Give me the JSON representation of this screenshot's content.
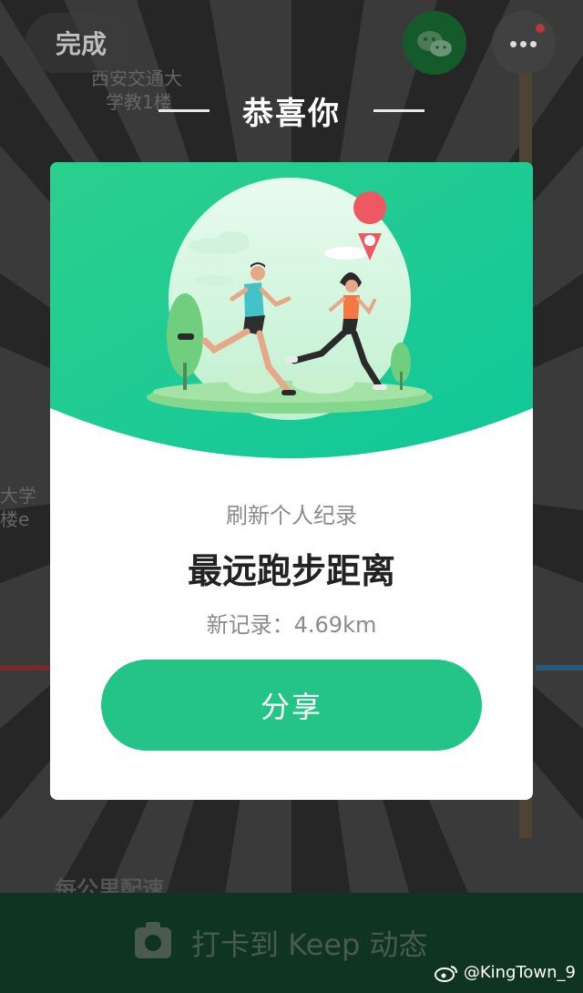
{
  "topbar": {
    "done_label": "完成"
  },
  "map_labels": [
    "西安交通大",
    "学教1楼",
    "大学",
    "楼e"
  ],
  "congrats": {
    "title": "恭喜你"
  },
  "card": {
    "subtitle": "刷新个人纪录",
    "title": "最远跑步距离",
    "record_text": "新记录：4.69km",
    "share_label": "分享"
  },
  "behind": {
    "pace_label": "每公里配速",
    "checkin_label": "打卡到 Keep 动态"
  },
  "watermark": {
    "text": "@KingTown_9"
  },
  "colors": {
    "accent": "#24c489",
    "card_header": "#1fca8d"
  }
}
